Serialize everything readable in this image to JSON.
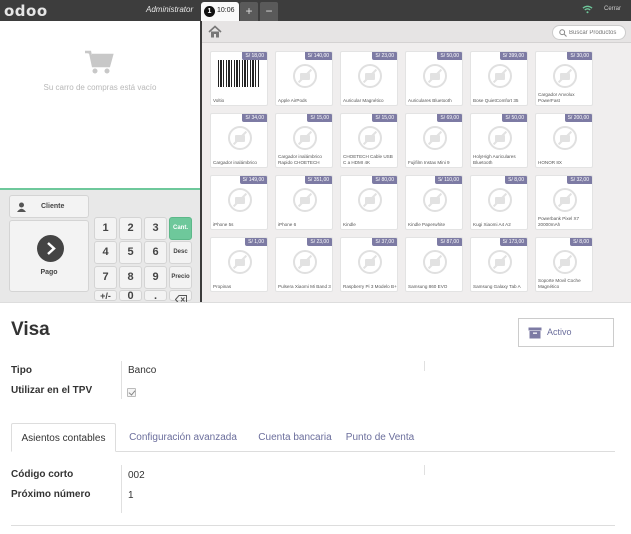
{
  "pos": {
    "logo": "odoo",
    "user": "Administrator",
    "order_tab": {
      "number": "1",
      "time": "10:06"
    },
    "add_order": "+",
    "remove_order": "−",
    "close": "Cerrar",
    "cart_empty": "Su carro de compras está vacío",
    "customer": "Cliente",
    "payment": "Pago",
    "keys": [
      "1",
      "2",
      "3",
      "4",
      "5",
      "6",
      "7",
      "8",
      "9",
      "+/-",
      "0",
      "."
    ],
    "mode_keys": [
      "Cant.",
      "Desc",
      "Precio"
    ],
    "search_placeholder": "Buscar Productos",
    "products": [
      {
        "name": "Voltio",
        "price": "S/ 18,00",
        "barcode": true
      },
      {
        "name": "Apple AirPods",
        "price": "S/ 140,00"
      },
      {
        "name": "Auricular Magnético",
        "price": "S/ 23,00"
      },
      {
        "name": "Auriculares Bluetooth",
        "price": "S/ 50,00"
      },
      {
        "name": "Bose QuietComfort 35",
        "price": "S/ 399,00"
      },
      {
        "name": "Cargador Anvolux PowerFast",
        "price": "S/ 30,00"
      },
      {
        "name": "Cargador inalámbrico",
        "price": "S/ 34,00"
      },
      {
        "name": "Cargador inalámbrico Rapido CHOETECH",
        "price": "S/ 15,00"
      },
      {
        "name": "CHOETECH Cable USB C a HDMI 4K",
        "price": "S/ 15,00"
      },
      {
        "name": "Fujifilm Instax Mini 9",
        "price": "S/ 69,00"
      },
      {
        "name": "HolyHigh Auriculares Bluetooth",
        "price": "S/ 50,00"
      },
      {
        "name": "HONOR 8X",
        "price": "S/ 200,00"
      },
      {
        "name": "iPhone 5s",
        "price": "S/ 149,00"
      },
      {
        "name": "iPhone 6",
        "price": "S/ 351,00"
      },
      {
        "name": "Kindle",
        "price": "S/ 80,00"
      },
      {
        "name": "Kindle Paperwhite",
        "price": "S/ 110,00"
      },
      {
        "name": "Kugi Xiaomi A4 A2",
        "price": "S/ 8,00"
      },
      {
        "name": "Powerbank Pixel X7 20000mAh",
        "price": "S/ 32,00"
      },
      {
        "name": "Propinas",
        "price": "S/ 1,00"
      },
      {
        "name": "Pulsera Xiaomi Mi Band 3",
        "price": "S/ 23,00"
      },
      {
        "name": "Raspberry Pi 3 Modelo B+",
        "price": "S/ 37,00"
      },
      {
        "name": "Samsung 860 EVO",
        "price": "S/ 87,00"
      },
      {
        "name": "Samsung Galaxy Tab A",
        "price": "S/ 173,00"
      },
      {
        "name": "Soporte Movil Coche Magnético",
        "price": "S/ 8,00"
      }
    ]
  },
  "form": {
    "title": "Visa",
    "active_button": "Activo",
    "tipo_label": "Tipo",
    "tipo_value": "Banco",
    "tpv_label": "Utilizar en el TPV",
    "tabs": [
      "Asientos contables",
      "Configuración avanzada",
      "Cuenta bancaria",
      "Punto de Venta"
    ],
    "codigo_label": "Código corto",
    "codigo_value": "002",
    "proximo_label": "Próximo número",
    "proximo_value": "1"
  },
  "colors": {
    "accent_green": "#6ec89b",
    "price_badge": "#7d7ba4",
    "link": "#6b6e9c"
  }
}
